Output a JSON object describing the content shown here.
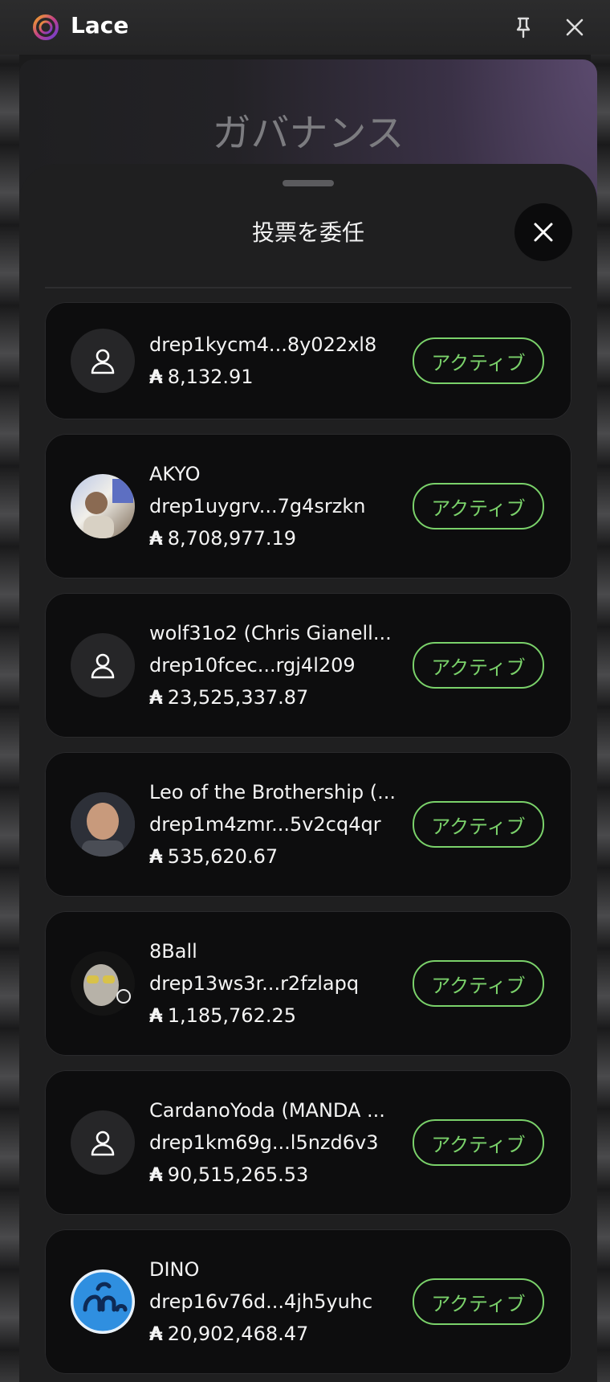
{
  "window": {
    "app_name": "Lace"
  },
  "background": {
    "page_title": "ガバナンス"
  },
  "sheet": {
    "title": "投票を委任"
  },
  "colors": {
    "accent_green": "#7ad16a",
    "card_bg": "#0d0d0e",
    "sheet_bg": "#1f1f20"
  },
  "dreps": [
    {
      "name": "",
      "id": "drep1kycm4...8y022xl8",
      "amount": "8,132.91",
      "status": "アクティブ",
      "avatar": "user-placeholder-icon"
    },
    {
      "name": "AKYO",
      "id": "drep1uygrv...7g4srzkn",
      "amount": "8,708,977.19",
      "status": "アクティブ",
      "avatar": "photo"
    },
    {
      "name": "wolf31o2 (Chris Gianell...",
      "id": "drep10fcec...rgj4l209",
      "amount": "23,525,337.87",
      "status": "アクティブ",
      "avatar": "user-placeholder-icon"
    },
    {
      "name": "Leo of the Brothership (...",
      "id": "drep1m4zmr...5v2cq4qr",
      "amount": "535,620.67",
      "status": "アクティブ",
      "avatar": "photo"
    },
    {
      "name": "8Ball",
      "id": "drep13ws3r...r2fzlapq",
      "amount": "1,185,762.25",
      "status": "アクティブ",
      "avatar": "photo"
    },
    {
      "name": "CardanoYoda (MANDA ...",
      "id": "drep1km69g...l5nzd6v3",
      "amount": "90,515,265.53",
      "status": "アクティブ",
      "avatar": "user-placeholder-icon"
    },
    {
      "name": "DINO",
      "id": "drep16v76d...4jh5yuhc",
      "amount": "20,902,468.47",
      "status": "アクティブ",
      "avatar": "photo"
    }
  ]
}
